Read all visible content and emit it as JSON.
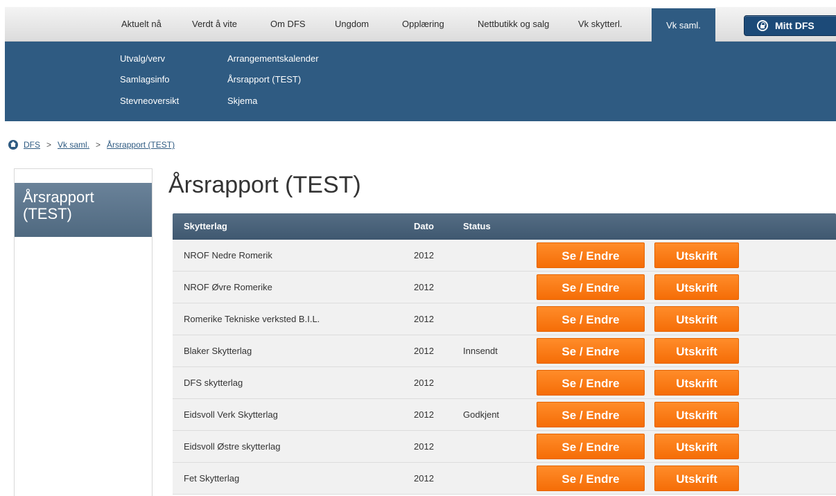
{
  "topnav": {
    "tabs": [
      {
        "label": "Aktuelt nå"
      },
      {
        "label": "Verdt å vite"
      },
      {
        "label": "Om DFS"
      },
      {
        "label": "Ungdom"
      },
      {
        "label": "Opplæring"
      },
      {
        "label": "Nettbutikk og salg"
      },
      {
        "label": "Vk skytterl."
      },
      {
        "label": "Vk saml.",
        "active": true
      }
    ],
    "login_label": "Mitt DFS"
  },
  "subnav": {
    "col1": [
      "Utvalg/verv",
      "Samlagsinfo",
      "Stevneoversikt"
    ],
    "col2": [
      "Arrangementskalender",
      "Årsrapport (TEST)",
      "Skjema"
    ]
  },
  "breadcrumb": {
    "items": [
      "DFS",
      "Vk saml.",
      "Årsrapport (TEST)"
    ],
    "separator": ">"
  },
  "sidebar": {
    "title": "Årsrapport (TEST)"
  },
  "page": {
    "title": "Årsrapport (TEST)"
  },
  "table": {
    "headers": {
      "club": "Skytterlag",
      "date": "Dato",
      "status": "Status"
    },
    "edit_label": "Se / Endre",
    "print_label": "Utskrift",
    "rows": [
      {
        "club": "NROF Nedre Romerik",
        "date": "2012",
        "status": ""
      },
      {
        "club": "NROF Øvre Romerike",
        "date": "2012",
        "status": ""
      },
      {
        "club": "Romerike Tekniske verksted B.I.L.",
        "date": "2012",
        "status": ""
      },
      {
        "club": "Blaker Skytterlag",
        "date": "2012",
        "status": "Innsendt"
      },
      {
        "club": "DFS skytterlag",
        "date": "2012",
        "status": ""
      },
      {
        "club": "Eidsvoll Verk Skytterlag",
        "date": "2012",
        "status": "Godkjent"
      },
      {
        "club": "Eidsvoll Østre skytterlag",
        "date": "2012",
        "status": ""
      },
      {
        "club": "Fet Skytterlag",
        "date": "2012",
        "status": ""
      }
    ]
  },
  "colors": {
    "nav_blue": "#2f5b82",
    "button_orange": "#f67a17",
    "header_slate": "#4a637b"
  }
}
